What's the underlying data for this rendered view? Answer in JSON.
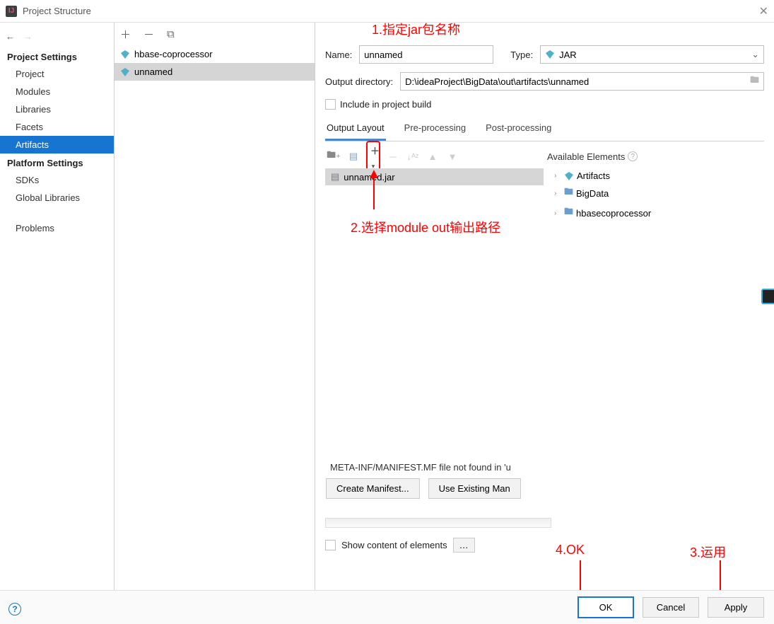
{
  "window": {
    "title": "Project Structure"
  },
  "sidebar": {
    "section1": "Project Settings",
    "items1": [
      "Project",
      "Modules",
      "Libraries",
      "Facets",
      "Artifacts"
    ],
    "selected1": "Artifacts",
    "section2": "Platform Settings",
    "items2": [
      "SDKs",
      "Global Libraries"
    ],
    "section3": "",
    "items3": [
      "Problems"
    ]
  },
  "artifacts": {
    "list": [
      "hbase-coprocessor",
      "unnamed"
    ],
    "selected": "unnamed"
  },
  "form": {
    "name_label": "Name:",
    "name_value": "unnamed",
    "type_label": "Type:",
    "type_value": "JAR",
    "outdir_label": "Output directory:",
    "outdir_value": "D:\\ideaProject\\BigData\\out\\artifacts\\unnamed",
    "include_build": "Include in project build"
  },
  "tabs": {
    "items": [
      "Output Layout",
      "Pre-processing",
      "Post-processing"
    ],
    "active": "Output Layout"
  },
  "layout": {
    "jar_name": "unnamed.jar",
    "available_header": "Available Elements",
    "tree": [
      "Artifacts",
      "BigData",
      "hbasecoprocessor"
    ]
  },
  "manifest": {
    "message": "META-INF/MANIFEST.MF file not found in 'u",
    "create_btn": "Create Manifest...",
    "use_btn": "Use Existing Man"
  },
  "show_content": "Show content of elements",
  "footer": {
    "ok": "OK",
    "cancel": "Cancel",
    "apply": "Apply"
  },
  "annotations": {
    "a1": "1.指定jar包名称",
    "a2": "2.选择module out输出路径",
    "a3": "3.运用",
    "a4": "4.OK"
  }
}
